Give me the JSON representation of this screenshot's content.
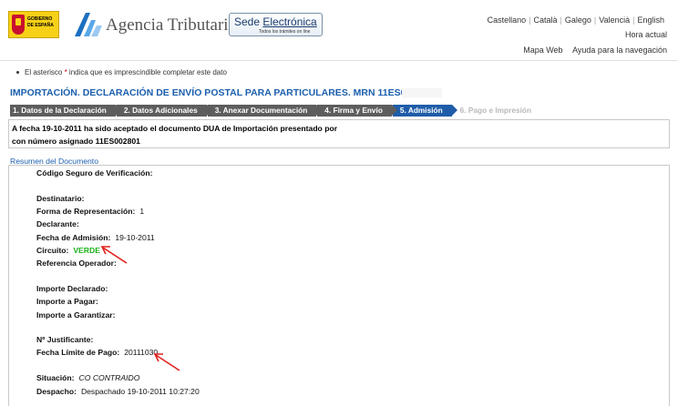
{
  "header": {
    "gobierno_text": "GOBIERNO DE ESPAÑA",
    "agency_name": "Agencia Tributaria",
    "sede_title_1": "Sede ",
    "sede_title_2": "Electrónica",
    "sede_subtitle": "Todos los trámites on line",
    "languages": [
      "Castellano",
      "Català",
      "Galego",
      "Valencià",
      "English"
    ],
    "hora_actual": "Hora actual",
    "links": [
      "Mapa Web",
      "Ayuda para la navegación"
    ]
  },
  "notice": {
    "before": "El asterisco ",
    "asterisk": "*",
    "after": " indica que es imprescindible completar este dato"
  },
  "page_title": "IMPORTACIÓN. DECLARACIÓN DE ENVÍO POSTAL PARA PARTICULARES. MRN 11ES002801",
  "steps": [
    {
      "label": "1. Datos de la Declaración",
      "state": "done"
    },
    {
      "label": "2. Datos Adicionales",
      "state": "done"
    },
    {
      "label": "3. Anexar Documentación",
      "state": "done"
    },
    {
      "label": "4. Firma y Envío",
      "state": "done"
    },
    {
      "label": "5. Admisión",
      "state": "active"
    },
    {
      "label": "6. Pago e Impresión",
      "state": "pending"
    }
  ],
  "message": {
    "line1": "A fecha 19-10-2011 ha sido aceptado el documento DUA de Importación presentado por",
    "line2": "con número asignado 11ES002801"
  },
  "summary": {
    "title": "Resumen del Documento",
    "fields": [
      {
        "label": "Código Seguro de Verificación:",
        "value": ""
      },
      {
        "label": "Destinatario:",
        "value": ""
      },
      {
        "label": "Forma de Representación:",
        "value": "1"
      },
      {
        "label": "Declarante:",
        "value": ""
      },
      {
        "label": "Fecha de Admisión:",
        "value": "19-10-2011"
      },
      {
        "label": "Circuito:",
        "value": "VERDE"
      },
      {
        "label": "Referencia Operador:",
        "value": ""
      },
      {
        "label": "Importe Declarado:",
        "value": ""
      },
      {
        "label": "Importe a Pagar:",
        "value": ""
      },
      {
        "label": "Importe a Garantizar:",
        "value": ""
      },
      {
        "label": "Nº Justificante:",
        "value": ""
      },
      {
        "label": "Fecha Límite de Pago:",
        "value": "20111030"
      },
      {
        "label": "Situación:",
        "value": "CO CONTRAIDO"
      },
      {
        "label": "Despacho:",
        "value": "Despachado 19-10-2011 10:27:20"
      }
    ]
  },
  "colors": {
    "title_blue": "#1b5fae",
    "active_step": "#1f5da8",
    "done_step": "#5d5d5d",
    "verde": "#19b319",
    "arrow_red": "#e0201c"
  }
}
